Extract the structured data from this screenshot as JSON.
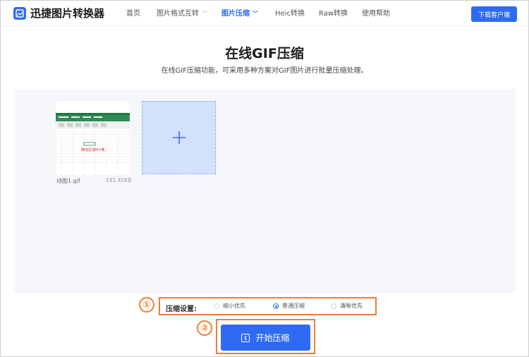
{
  "app": {
    "name": "迅捷图片转换器"
  },
  "nav": {
    "items": [
      {
        "label": "首页",
        "active": false,
        "dropdown": false
      },
      {
        "label": "图片格式互转",
        "active": false,
        "dropdown": true
      },
      {
        "label": "图片压缩",
        "active": true,
        "dropdown": true
      },
      {
        "label": "Heic转换",
        "active": false,
        "dropdown": false
      },
      {
        "label": "Raw转换",
        "active": false,
        "dropdown": false
      },
      {
        "label": "使用帮助",
        "active": false,
        "dropdown": false
      }
    ],
    "download_label": "下载客户端"
  },
  "page": {
    "title": "在线GIF压缩",
    "subtitle": "在线GIF压缩功能，可采用多种方案对GIF图片进行批量压缩处理。"
  },
  "upload": {
    "file": {
      "name": "动图1.gif",
      "size": "141.45KB",
      "preview_text": "降级区域M=乘"
    },
    "add_icon": "plus-icon"
  },
  "settings": {
    "label": "压缩设置:",
    "options": [
      {
        "label": "缩小优先",
        "selected": false
      },
      {
        "label": "普通压缩",
        "selected": true
      },
      {
        "label": "清晰优先",
        "selected": false
      }
    ],
    "marker": "①"
  },
  "start": {
    "label": "开始压缩",
    "marker": "②"
  },
  "colors": {
    "accent": "#2f6bf2",
    "highlight": "#ee7d3a",
    "tile": "#d2e1fc"
  }
}
